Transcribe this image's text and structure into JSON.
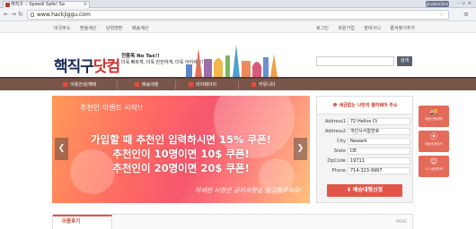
{
  "browser": {
    "tab_title": "핵직구 :: Speedi Safe! Sa",
    "profile": "pluskim3mn",
    "url": "www.hackjiggu.com"
  },
  "utility_nav": {
    "left": [
      "미국주소",
      "환율계산",
      "단위변환",
      "배송계산"
    ],
    "right": [
      "로그인",
      "회원가입",
      "장바구니",
      "즐겨찾기추가"
    ]
  },
  "header": {
    "logo_main": "핵직구",
    "logo_accent": "닷컴",
    "tagline_1": "전품목 No Tax!!",
    "tagline_2": "더욱 빠르게, 더욱 안전하게, 더욱 아끼세요!",
    "search_placeholder": "",
    "search_button": "검색"
  },
  "main_nav": [
    "이용안내/혜택",
    "배송대행",
    "마이페이지",
    "커뮤니티"
  ],
  "slider": {
    "title": "추천인 이벤트 시작!!",
    "line1": "가입할 때 추천인 입력하시면 15% 쿠폰!",
    "line2": "추천인이 10명이면 10$ 쿠폰!",
    "line3": "추천인이 20명이면 20$ 쿠폰!",
    "footer": "자세한 사항은 공지사항을 참고해주세요!",
    "prev": "❮",
    "next": "❯"
  },
  "address_panel": {
    "title": "세금없는 나만의 델라웨어 주소",
    "rows": [
      {
        "label": "Address1",
        "value": "72 Hellos Ct"
      },
      {
        "label": "Address2",
        "value": "개인사서함번호"
      },
      {
        "label": "City",
        "value": "Newark"
      },
      {
        "label": "State",
        "value": "DE"
      },
      {
        "label": "ZipCode",
        "value": "19711"
      },
      {
        "label": "Phone",
        "value": "714-323-9997"
      }
    ],
    "button": "배송대행신청"
  },
  "side_cards": [
    {
      "icon": "🚚",
      "label": "배송신청내역"
    },
    {
      "icon": "⦿",
      "label": "배송비계산기"
    },
    {
      "icon": "☺",
      "label": "1:1 상담문의"
    }
  ],
  "bottom": {
    "tab_label": "이용후기",
    "more": "MORE"
  },
  "colors": {
    "nav_brown": "#7a5549",
    "accent_red": "#e25649",
    "logo_navy": "#1d2b5a"
  }
}
